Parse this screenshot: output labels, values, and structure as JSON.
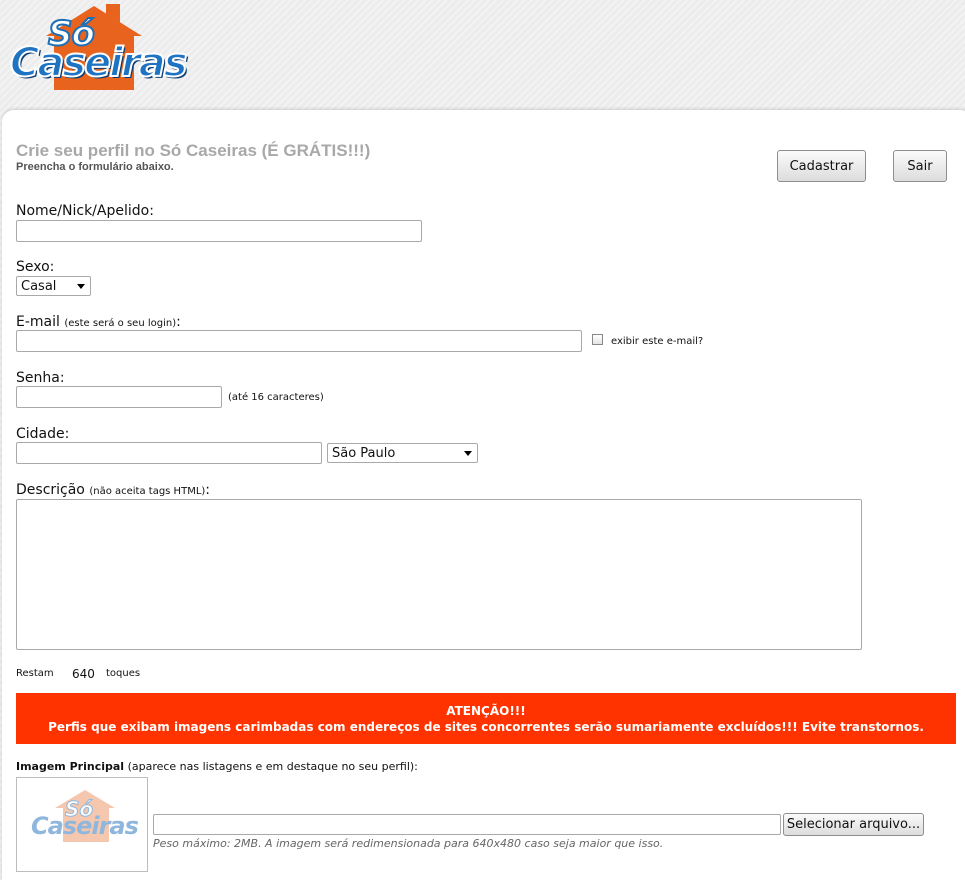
{
  "brand": {
    "logo_top": "Só",
    "logo_bottom": "Caseiras"
  },
  "header": {
    "title": "Crie seu perfil no Só Caseiras (É GRÁTIS!!!)",
    "subtitle": "Preencha o formulário abaixo."
  },
  "actions": {
    "register_label": "Cadastrar",
    "exit_label": "Sair"
  },
  "form": {
    "name": {
      "label": "Nome/Nick/Apelido:",
      "value": ""
    },
    "gender": {
      "label": "Sexo:",
      "selected": "Casal"
    },
    "email": {
      "label": "E-mail",
      "hint": "(este será o seu login)",
      "suffix": ":",
      "value": "",
      "show_label": "exibir este e-mail?"
    },
    "password": {
      "label": "Senha:",
      "hint": "(até 16 caracteres)",
      "value": ""
    },
    "city": {
      "label": "Cidade:",
      "value": "",
      "state_selected": "São Paulo"
    },
    "description": {
      "label": "Descrição",
      "hint": "(não aceita tags HTML)",
      "suffix": ":",
      "value": ""
    },
    "counter": {
      "prefix": "Restam",
      "count": "640",
      "suffix": "toques"
    }
  },
  "warning": {
    "title": "ATENÇÃO!!!",
    "text": "Perfis que exibam imagens carimbadas com endereços de sites concorrentes serão sumariamente excluídos!!! Evite transtornos."
  },
  "image": {
    "label_bold": "Imagem Principal",
    "label_rest": "(aparece nas listagens e em destaque no seu perfil):",
    "select_label": "Selecionar arquivo...",
    "note": "Peso máximo: 2MB. A imagem será redimensionada para 640x480 caso seja maior que isso.",
    "placeholder_top": "Só",
    "placeholder_bottom": "Caseiras"
  },
  "colors": {
    "warning_bg": "#ff3300",
    "logo_orange": "#e8631d",
    "logo_blue": "#1e73c2"
  }
}
